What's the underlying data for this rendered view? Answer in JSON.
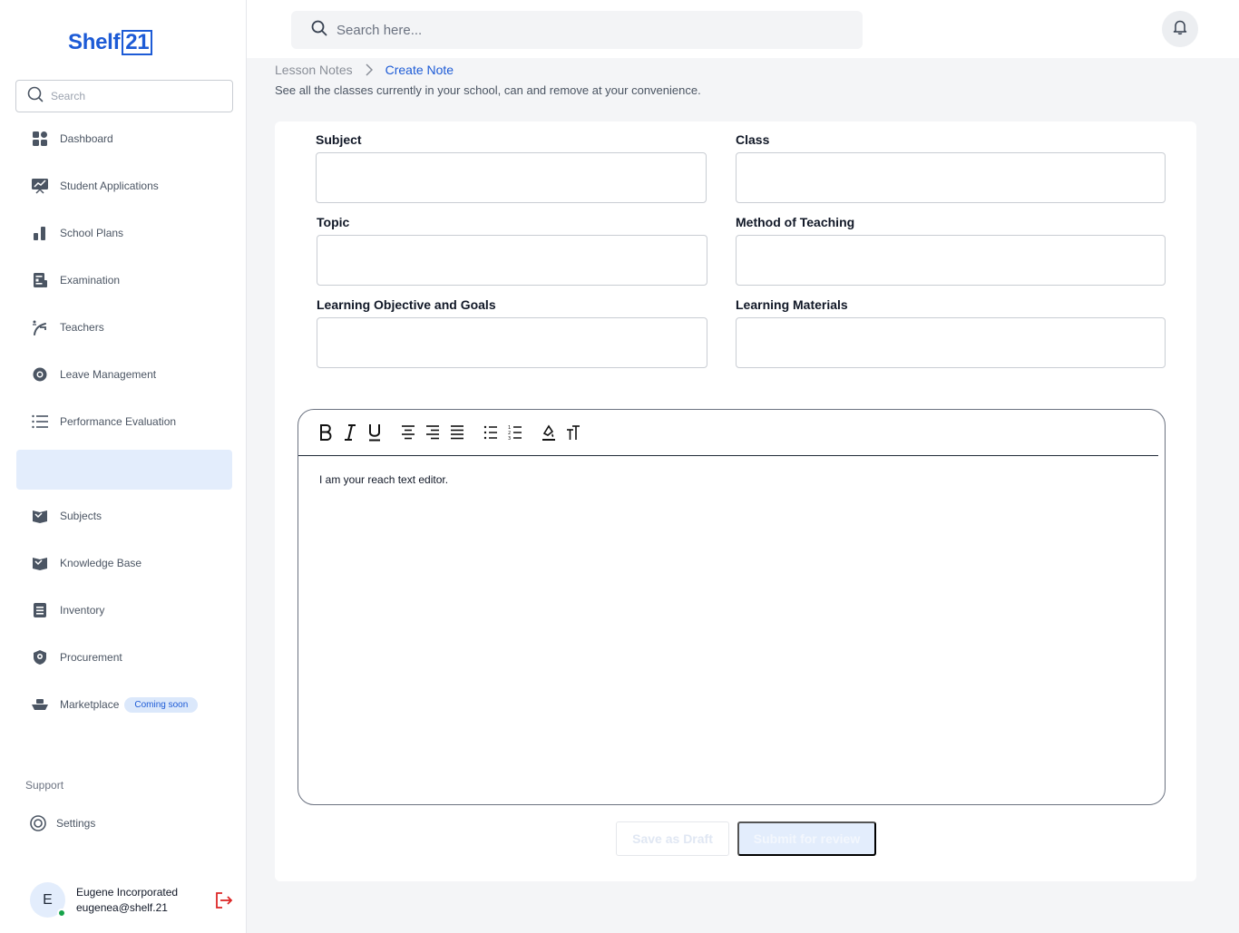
{
  "brand": {
    "name": "Shelf",
    "suffix": "21",
    "color": "#1d5bd6"
  },
  "sidebar": {
    "search_placeholder": "Search",
    "items": [
      {
        "label": "Dashboard",
        "icon": "dashboard-icon"
      },
      {
        "label": "Student Applications",
        "icon": "presentation-chart-icon"
      },
      {
        "label": "School Plans",
        "icon": "bar-chart-icon"
      },
      {
        "label": "Examination",
        "icon": "exam-document-icon"
      },
      {
        "label": "Teachers",
        "icon": "teacher-icon"
      },
      {
        "label": "Leave Management",
        "icon": "lifebuoy-icon"
      },
      {
        "label": "Performance Evaluation",
        "icon": "list-icon"
      },
      {
        "label": "",
        "icon": ""
      },
      {
        "label": "Subjects",
        "icon": "book-icon"
      },
      {
        "label": "Knowledge Base",
        "icon": "book-icon"
      },
      {
        "label": "Inventory",
        "icon": "inventory-icon"
      },
      {
        "label": "Procurement",
        "icon": "shield-icon"
      },
      {
        "label": "Marketplace",
        "icon": "boat-icon",
        "badge": "Coming soon"
      }
    ],
    "support_label": "Support",
    "settings_label": "Settings"
  },
  "user": {
    "initial": "E",
    "name": "Eugene Incorporated",
    "email": "eugenea@shelf.21"
  },
  "topbar": {
    "search_placeholder": "Search here..."
  },
  "breadcrumb": {
    "parent": "Lesson Notes",
    "current": "Create Note"
  },
  "subtitle": "See all the classes currently in your school, can and remove at your convenience.",
  "form": {
    "subject_label": "Subject",
    "class_label": "Class",
    "topic_label": "Topic",
    "method_label": "Method of Teaching",
    "objective_label": "Learning Objective and Goals",
    "materials_label": "Learning Materials"
  },
  "editor": {
    "content": "I am your reach text editor.",
    "toolbar": [
      "bold-icon",
      "italic-icon",
      "underline-icon",
      "align-center-icon",
      "align-right-icon",
      "align-justify-icon",
      "bullet-list-icon",
      "numbered-list-icon",
      "text-color-icon",
      "text-size-icon"
    ]
  },
  "actions": {
    "draft_label": "Save as Draft",
    "submit_label": "Submit for review"
  },
  "colors": {
    "accent": "#1d5bd6",
    "active_bg": "#e3edfc",
    "online": "#16a34a",
    "logout": "#dc2626"
  }
}
